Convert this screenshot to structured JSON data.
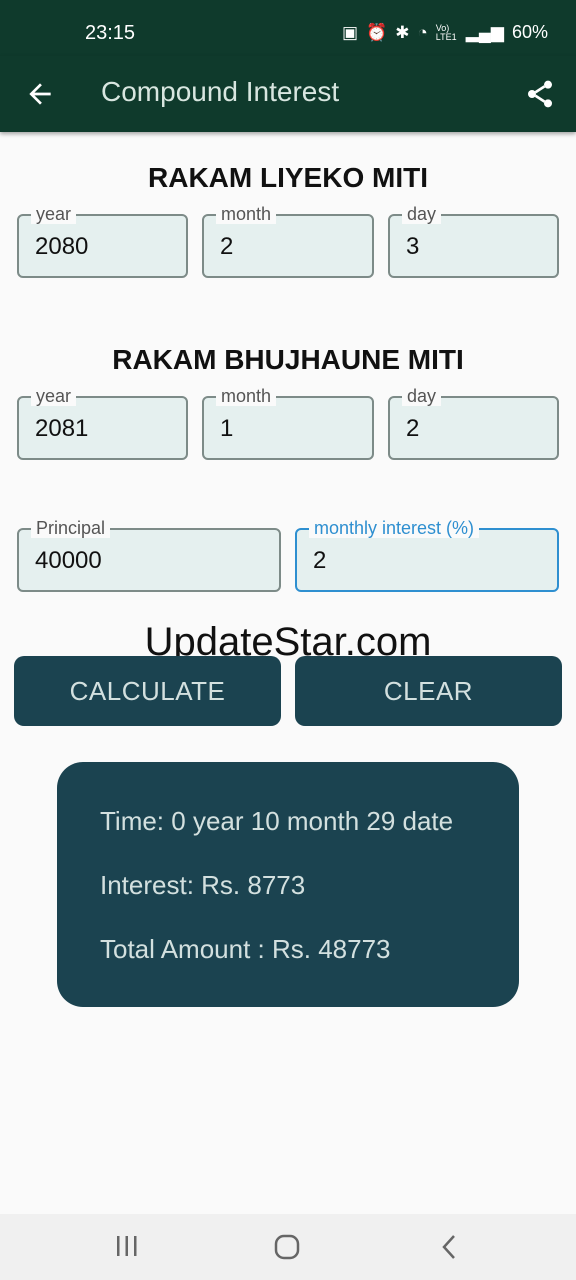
{
  "status_bar": {
    "time": "23:15",
    "icons": [
      "sim-icon",
      "alarm-icon",
      "bluetooth-icon",
      "wifi-icon",
      "volte-icon",
      "signal-icon"
    ],
    "volte_text": "Vo) LTE1",
    "battery": "60%"
  },
  "app_bar": {
    "title": "Compound Interest",
    "background": "#0f3a2c"
  },
  "section1": {
    "heading": "RAKAM LIYEKO MITI",
    "year": {
      "label": "year",
      "value": "2080"
    },
    "month": {
      "label": "month",
      "value": "2"
    },
    "day": {
      "label": "day",
      "value": "3"
    }
  },
  "section2": {
    "heading": "RAKAM BHUJHAUNE MITI",
    "year": {
      "label": "year",
      "value": "2081"
    },
    "month": {
      "label": "month",
      "value": "1"
    },
    "day": {
      "label": "day",
      "value": "2"
    }
  },
  "principal": {
    "label": "Principal",
    "value": "40000"
  },
  "interest": {
    "label": "monthly interest (%)",
    "value": "2"
  },
  "watermark": "UpdateStar.com",
  "buttons": {
    "calculate": "CALCULATE",
    "clear": "CLEAR",
    "color": "#1b4350"
  },
  "result": {
    "time": "Time: 0 year 10 month 29 date",
    "interest": "Interest: Rs. 8773",
    "total": "Total Amount : Rs. 48773"
  }
}
